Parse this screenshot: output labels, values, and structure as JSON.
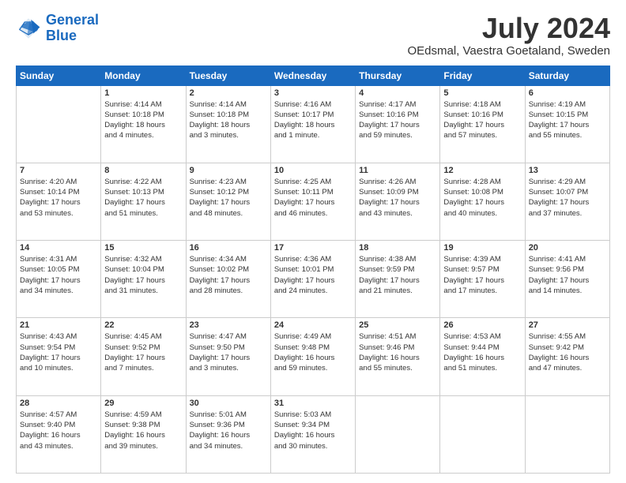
{
  "header": {
    "logo_line1": "General",
    "logo_line2": "Blue",
    "title": "July 2024",
    "subtitle": "OEdsmal, Vaestra Goetaland, Sweden"
  },
  "days_of_week": [
    "Sunday",
    "Monday",
    "Tuesday",
    "Wednesday",
    "Thursday",
    "Friday",
    "Saturday"
  ],
  "weeks": [
    [
      {
        "day": "",
        "info": ""
      },
      {
        "day": "1",
        "info": "Sunrise: 4:14 AM\nSunset: 10:18 PM\nDaylight: 18 hours\nand 4 minutes."
      },
      {
        "day": "2",
        "info": "Sunrise: 4:14 AM\nSunset: 10:18 PM\nDaylight: 18 hours\nand 3 minutes."
      },
      {
        "day": "3",
        "info": "Sunrise: 4:16 AM\nSunset: 10:17 PM\nDaylight: 18 hours\nand 1 minute."
      },
      {
        "day": "4",
        "info": "Sunrise: 4:17 AM\nSunset: 10:16 PM\nDaylight: 17 hours\nand 59 minutes."
      },
      {
        "day": "5",
        "info": "Sunrise: 4:18 AM\nSunset: 10:16 PM\nDaylight: 17 hours\nand 57 minutes."
      },
      {
        "day": "6",
        "info": "Sunrise: 4:19 AM\nSunset: 10:15 PM\nDaylight: 17 hours\nand 55 minutes."
      }
    ],
    [
      {
        "day": "7",
        "info": "Sunrise: 4:20 AM\nSunset: 10:14 PM\nDaylight: 17 hours\nand 53 minutes."
      },
      {
        "day": "8",
        "info": "Sunrise: 4:22 AM\nSunset: 10:13 PM\nDaylight: 17 hours\nand 51 minutes."
      },
      {
        "day": "9",
        "info": "Sunrise: 4:23 AM\nSunset: 10:12 PM\nDaylight: 17 hours\nand 48 minutes."
      },
      {
        "day": "10",
        "info": "Sunrise: 4:25 AM\nSunset: 10:11 PM\nDaylight: 17 hours\nand 46 minutes."
      },
      {
        "day": "11",
        "info": "Sunrise: 4:26 AM\nSunset: 10:09 PM\nDaylight: 17 hours\nand 43 minutes."
      },
      {
        "day": "12",
        "info": "Sunrise: 4:28 AM\nSunset: 10:08 PM\nDaylight: 17 hours\nand 40 minutes."
      },
      {
        "day": "13",
        "info": "Sunrise: 4:29 AM\nSunset: 10:07 PM\nDaylight: 17 hours\nand 37 minutes."
      }
    ],
    [
      {
        "day": "14",
        "info": "Sunrise: 4:31 AM\nSunset: 10:05 PM\nDaylight: 17 hours\nand 34 minutes."
      },
      {
        "day": "15",
        "info": "Sunrise: 4:32 AM\nSunset: 10:04 PM\nDaylight: 17 hours\nand 31 minutes."
      },
      {
        "day": "16",
        "info": "Sunrise: 4:34 AM\nSunset: 10:02 PM\nDaylight: 17 hours\nand 28 minutes."
      },
      {
        "day": "17",
        "info": "Sunrise: 4:36 AM\nSunset: 10:01 PM\nDaylight: 17 hours\nand 24 minutes."
      },
      {
        "day": "18",
        "info": "Sunrise: 4:38 AM\nSunset: 9:59 PM\nDaylight: 17 hours\nand 21 minutes."
      },
      {
        "day": "19",
        "info": "Sunrise: 4:39 AM\nSunset: 9:57 PM\nDaylight: 17 hours\nand 17 minutes."
      },
      {
        "day": "20",
        "info": "Sunrise: 4:41 AM\nSunset: 9:56 PM\nDaylight: 17 hours\nand 14 minutes."
      }
    ],
    [
      {
        "day": "21",
        "info": "Sunrise: 4:43 AM\nSunset: 9:54 PM\nDaylight: 17 hours\nand 10 minutes."
      },
      {
        "day": "22",
        "info": "Sunrise: 4:45 AM\nSunset: 9:52 PM\nDaylight: 17 hours\nand 7 minutes."
      },
      {
        "day": "23",
        "info": "Sunrise: 4:47 AM\nSunset: 9:50 PM\nDaylight: 17 hours\nand 3 minutes."
      },
      {
        "day": "24",
        "info": "Sunrise: 4:49 AM\nSunset: 9:48 PM\nDaylight: 16 hours\nand 59 minutes."
      },
      {
        "day": "25",
        "info": "Sunrise: 4:51 AM\nSunset: 9:46 PM\nDaylight: 16 hours\nand 55 minutes."
      },
      {
        "day": "26",
        "info": "Sunrise: 4:53 AM\nSunset: 9:44 PM\nDaylight: 16 hours\nand 51 minutes."
      },
      {
        "day": "27",
        "info": "Sunrise: 4:55 AM\nSunset: 9:42 PM\nDaylight: 16 hours\nand 47 minutes."
      }
    ],
    [
      {
        "day": "28",
        "info": "Sunrise: 4:57 AM\nSunset: 9:40 PM\nDaylight: 16 hours\nand 43 minutes."
      },
      {
        "day": "29",
        "info": "Sunrise: 4:59 AM\nSunset: 9:38 PM\nDaylight: 16 hours\nand 39 minutes."
      },
      {
        "day": "30",
        "info": "Sunrise: 5:01 AM\nSunset: 9:36 PM\nDaylight: 16 hours\nand 34 minutes."
      },
      {
        "day": "31",
        "info": "Sunrise: 5:03 AM\nSunset: 9:34 PM\nDaylight: 16 hours\nand 30 minutes."
      },
      {
        "day": "",
        "info": ""
      },
      {
        "day": "",
        "info": ""
      },
      {
        "day": "",
        "info": ""
      }
    ]
  ]
}
